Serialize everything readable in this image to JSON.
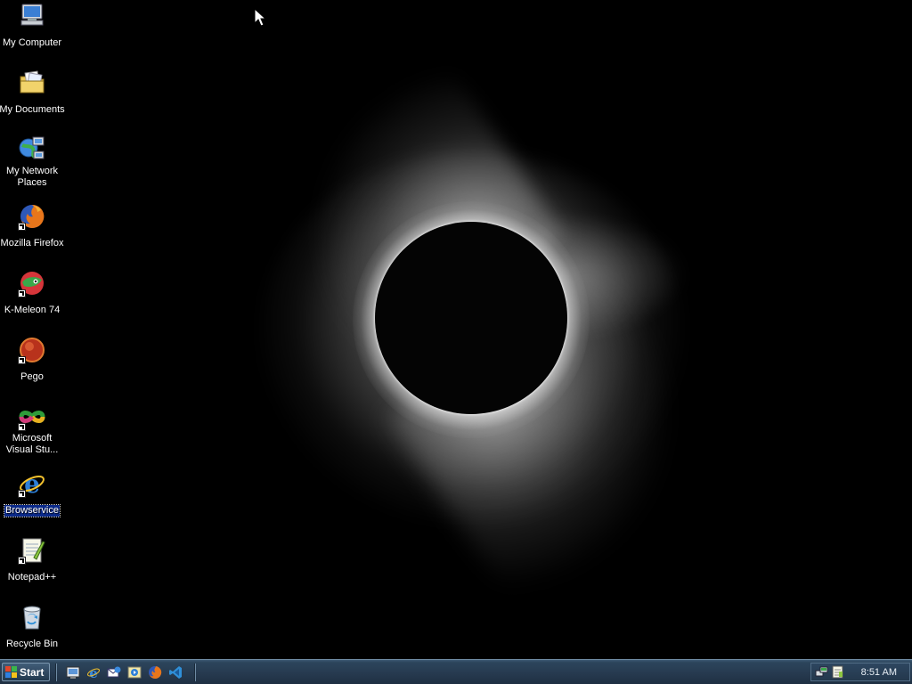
{
  "desktop": {
    "icons": [
      {
        "label": "My Computer",
        "icon": "computer-icon",
        "shortcut": false
      },
      {
        "label": "My Documents",
        "icon": "documents-folder-icon",
        "shortcut": false
      },
      {
        "label": "My Network Places",
        "icon": "network-icon",
        "shortcut": false
      },
      {
        "label": "Mozilla Firefox",
        "icon": "firefox-icon",
        "shortcut": true
      },
      {
        "label": "K-Meleon 74",
        "icon": "k-meleon-icon",
        "shortcut": true
      },
      {
        "label": "Pego",
        "icon": "pego-icon",
        "shortcut": true
      },
      {
        "label": "Microsoft Visual Stu...",
        "icon": "visual-studio-icon",
        "shortcut": true
      },
      {
        "label": "Browservice",
        "icon": "internet-explorer-icon",
        "shortcut": true,
        "selected": true
      },
      {
        "label": "Notepad++",
        "icon": "notepad-plus-plus-icon",
        "shortcut": true
      },
      {
        "label": "Recycle Bin",
        "icon": "recycle-bin-icon",
        "shortcut": false
      }
    ],
    "wallpaper": "solar-eclipse"
  },
  "taskbar": {
    "start_label": "Start",
    "quick_launch": [
      "show-desktop-icon",
      "internet-explorer-icon",
      "outlook-express-icon",
      "windows-media-icon",
      "firefox-icon",
      "visual-studio-code-icon"
    ],
    "tray_icons": [
      "network-tray-icon",
      "notepad-tray-icon"
    ],
    "clock": "8:51 AM"
  },
  "colors": {
    "taskbar": "#26394e",
    "selection": "#0b2a8a",
    "desktop_background": "#000000"
  }
}
